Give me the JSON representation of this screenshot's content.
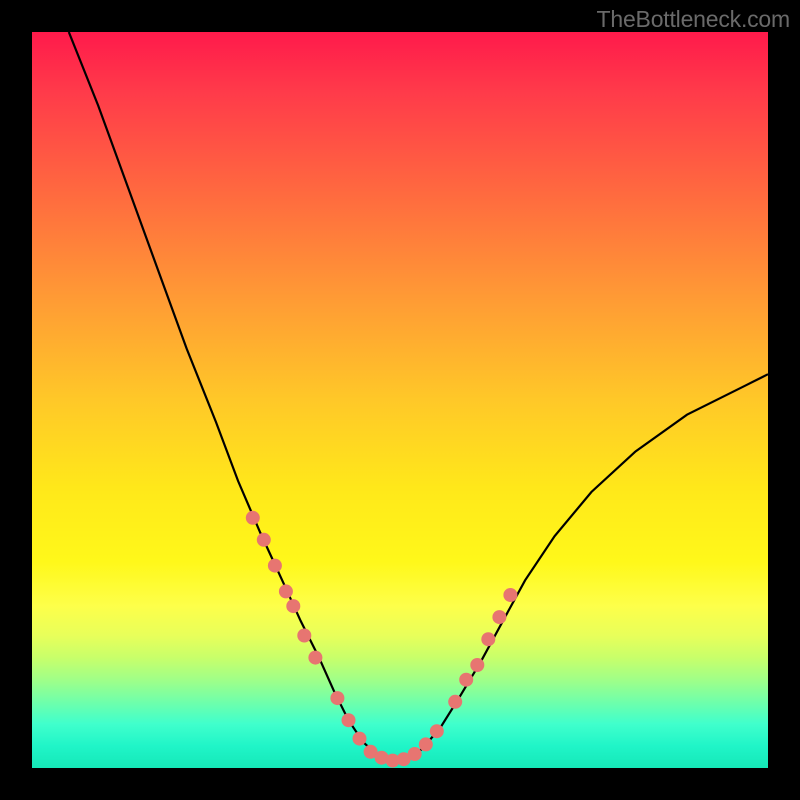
{
  "watermark": "TheBottleneck.com",
  "colors": {
    "frame": "#000000",
    "curve_stroke": "#000000",
    "dot_fill": "#e77571",
    "watermark": "#6a6a6a"
  },
  "chart_data": {
    "type": "line",
    "title": "",
    "xlabel": "",
    "ylabel": "",
    "xlim": [
      0,
      100
    ],
    "ylim": [
      0,
      100
    ],
    "legend": false,
    "annotations": [
      "TheBottleneck.com"
    ],
    "background_gradient": {
      "top": "#ff1a4b",
      "upper_mid": "#ffc828",
      "mid": "#fff81a",
      "lower": "#15e8b8"
    },
    "series": [
      {
        "name": "bottleneck-curve",
        "x": [
          5.0,
          9.0,
          13.0,
          17.0,
          21.0,
          25.0,
          28.0,
          31.0,
          34.0,
          36.5,
          39.0,
          41.0,
          43.0,
          45.0,
          47.0,
          49.0,
          51.0,
          53.0,
          55.5,
          58.0,
          61.0,
          64.0,
          67.0,
          71.0,
          76.0,
          82.0,
          89.0,
          97.0,
          100.0
        ],
        "y": [
          100.0,
          90.0,
          79.0,
          68.0,
          57.0,
          47.0,
          39.0,
          32.0,
          25.5,
          20.0,
          15.0,
          10.5,
          6.5,
          3.5,
          1.7,
          1.0,
          1.2,
          2.6,
          5.5,
          9.5,
          14.5,
          20.0,
          25.5,
          31.5,
          37.5,
          43.0,
          48.0,
          52.0,
          53.5
        ]
      },
      {
        "name": "sample-dots",
        "x": [
          30.0,
          31.5,
          33.0,
          34.5,
          35.5,
          37.0,
          38.5,
          41.5,
          43.0,
          44.5,
          46.0,
          47.5,
          49.0,
          50.5,
          52.0,
          53.5,
          55.0,
          57.5,
          59.0,
          60.5,
          62.0,
          63.5,
          65.0
        ],
        "y": [
          34.0,
          31.0,
          27.5,
          24.0,
          22.0,
          18.0,
          15.0,
          9.5,
          6.5,
          4.0,
          2.2,
          1.4,
          1.0,
          1.2,
          1.9,
          3.2,
          5.0,
          9.0,
          12.0,
          14.0,
          17.5,
          20.5,
          23.5
        ]
      }
    ]
  }
}
